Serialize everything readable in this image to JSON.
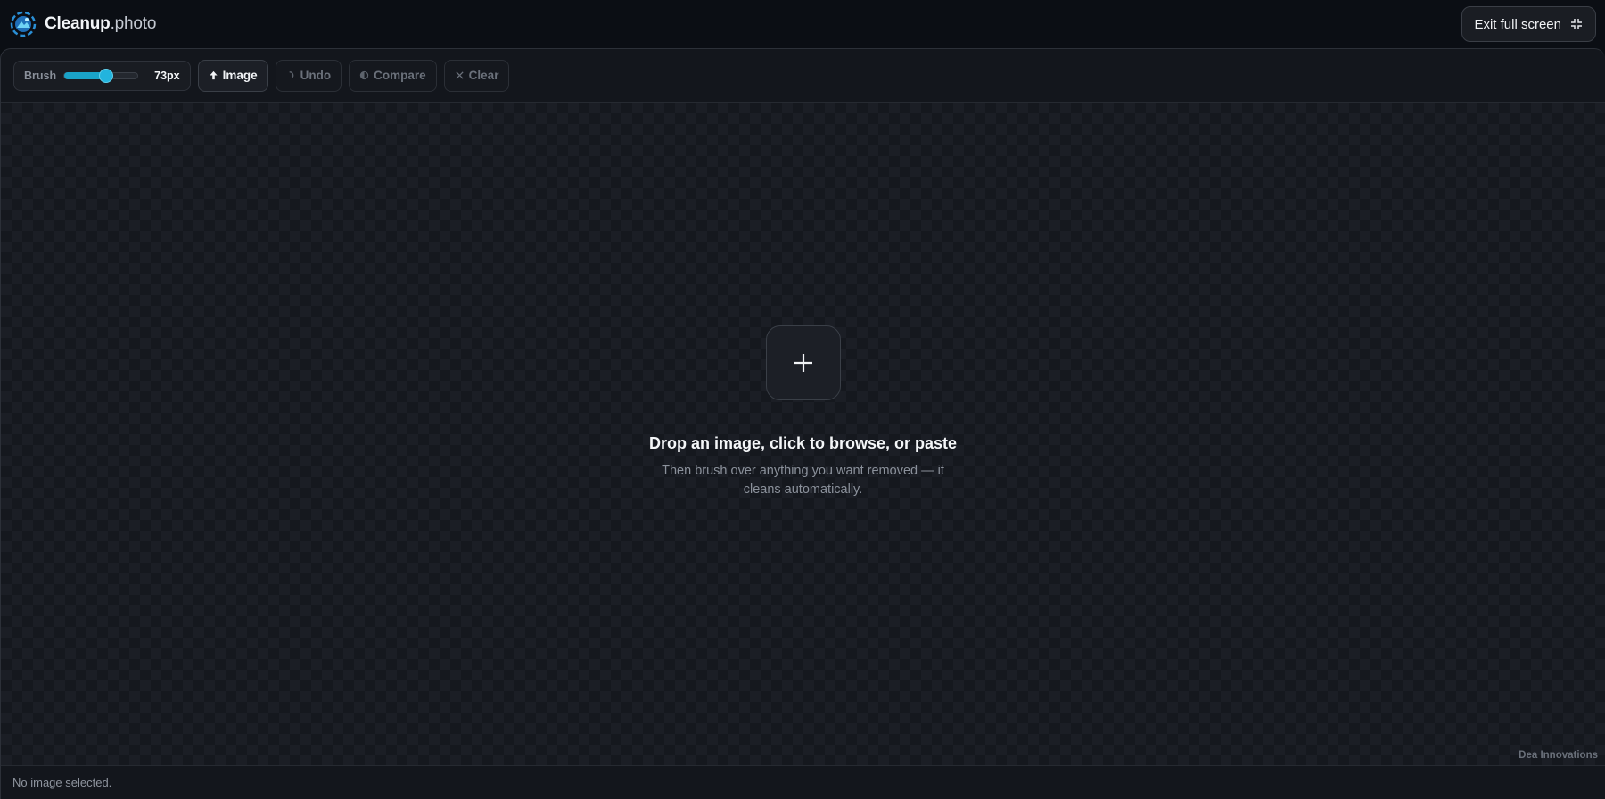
{
  "header": {
    "brand_bold": "Cleanup",
    "brand_light": ".photo",
    "logo_icon": "cleanup-photo-logo",
    "exit_label": "Exit full screen",
    "exit_icon": "exit-fullscreen-icon"
  },
  "toolbar": {
    "brush_label": "Brush",
    "brush_value": "73px",
    "brush_level_fraction": 0.57,
    "image_label": "Image",
    "undo_label": "Undo",
    "compare_label": "Compare",
    "clear_label": "Clear"
  },
  "canvas": {
    "drop_title": "Drop an image, click to browse, or paste",
    "drop_subtitle": "Then brush over anything you want removed — it cleans automatically.",
    "credit": "Dea Innovations"
  },
  "status": {
    "text": "No image selected."
  },
  "colors": {
    "accent": "#1aa3c8",
    "background": "#0b0e13",
    "panel": "#13161c"
  }
}
